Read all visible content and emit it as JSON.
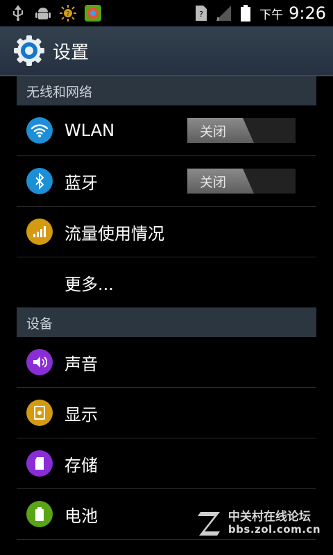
{
  "statusbar": {
    "icons": [
      "usb-icon",
      "android-debug-icon",
      "brightness-icon",
      "app-store-icon"
    ],
    "right_icons": [
      "sim-unknown-icon",
      "signal-icon",
      "battery-icon"
    ],
    "ampm": "下午",
    "time": "9:26"
  },
  "actionbar": {
    "title": "设置",
    "icon": "settings-gear-icon"
  },
  "sections": [
    {
      "header": "无线和网络",
      "items": [
        {
          "label": "WLAN",
          "icon": "wifi-icon",
          "toggle": "关闭"
        },
        {
          "label": "蓝牙",
          "icon": "bluetooth-icon",
          "toggle": "关闭"
        },
        {
          "label": "流量使用情况",
          "icon": "data-usage-icon"
        },
        {
          "label": "更多..."
        }
      ]
    },
    {
      "header": "设备",
      "items": [
        {
          "label": "声音",
          "icon": "speaker-icon"
        },
        {
          "label": "显示",
          "icon": "display-icon"
        },
        {
          "label": "存储",
          "icon": "sd-card-icon"
        },
        {
          "label": "电池",
          "icon": "battery-icon"
        }
      ]
    }
  ],
  "colors": {
    "wifi": "#1d8fd6",
    "bluetooth": "#1d8fd6",
    "data_usage": "#d49a12",
    "sound": "#8a2dd6",
    "display": "#d49a12",
    "storage": "#8a2dd6",
    "battery": "#5aa516",
    "section_header_bg": "#2c3641",
    "actionbar_bg": "#2c3847"
  },
  "watermark": {
    "cn": "中关村在线论坛",
    "url": "bbs.zol.com.cn"
  }
}
